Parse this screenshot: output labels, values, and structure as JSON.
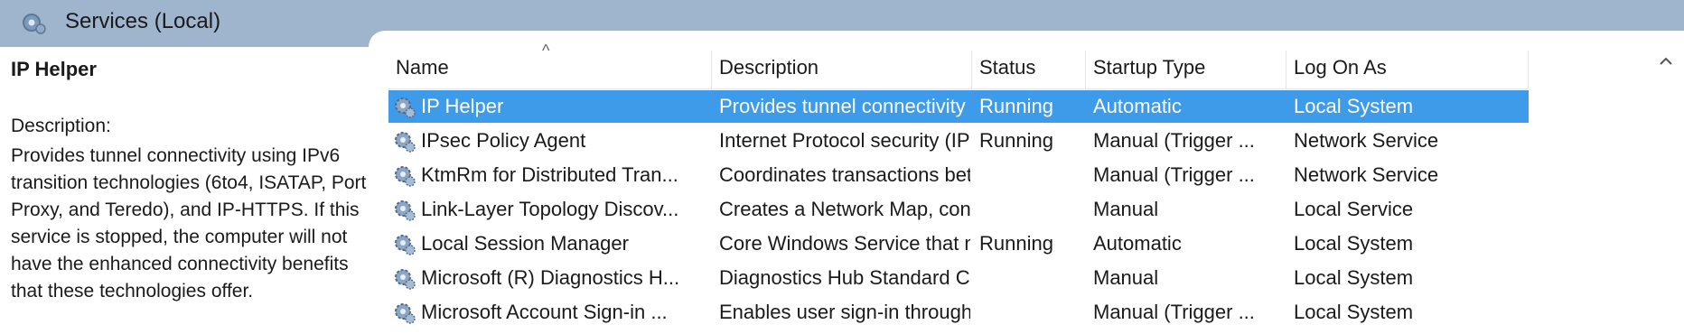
{
  "window": {
    "title": "Services (Local)"
  },
  "details": {
    "service_name": "IP Helper",
    "description_label": "Description:",
    "description": "Provides tunnel connectivity using IPv6 transition technologies (6to4, ISATAP, Port Proxy, and Teredo), and IP-HTTPS. If this service is stopped, the computer will not have the enhanced connectivity benefits that these technologies offer."
  },
  "table": {
    "columns": [
      "Name",
      "Description",
      "Status",
      "Startup Type",
      "Log On As"
    ],
    "sort_indicator": "^",
    "rows": [
      {
        "name": "IP Helper",
        "description": "Provides tunnel connectivity ...",
        "status": "Running",
        "startup": "Automatic",
        "logon": "Local System",
        "selected": true
      },
      {
        "name": "IPsec Policy Agent",
        "description": "Internet Protocol security (IPs...",
        "status": "Running",
        "startup": "Manual (Trigger ...",
        "logon": "Network Service"
      },
      {
        "name": "KtmRm for Distributed Tran...",
        "description": "Coordinates transactions bet...",
        "status": "",
        "startup": "Manual (Trigger ...",
        "logon": "Network Service"
      },
      {
        "name": "Link-Layer Topology Discov...",
        "description": "Creates a Network Map, cons...",
        "status": "",
        "startup": "Manual",
        "logon": "Local Service"
      },
      {
        "name": "Local Session Manager",
        "description": "Core Windows Service that m...",
        "status": "Running",
        "startup": "Automatic",
        "logon": "Local System"
      },
      {
        "name": "Microsoft (R) Diagnostics H...",
        "description": "Diagnostics Hub Standard Co...",
        "status": "",
        "startup": "Manual",
        "logon": "Local System"
      },
      {
        "name": "Microsoft Account Sign-in ...",
        "description": "Enables user sign-in through ...",
        "status": "",
        "startup": "Manual (Trigger ...",
        "logon": "Local System"
      }
    ]
  },
  "colors": {
    "titlebar": "#9fb4cd",
    "selection": "#3d9be9"
  }
}
